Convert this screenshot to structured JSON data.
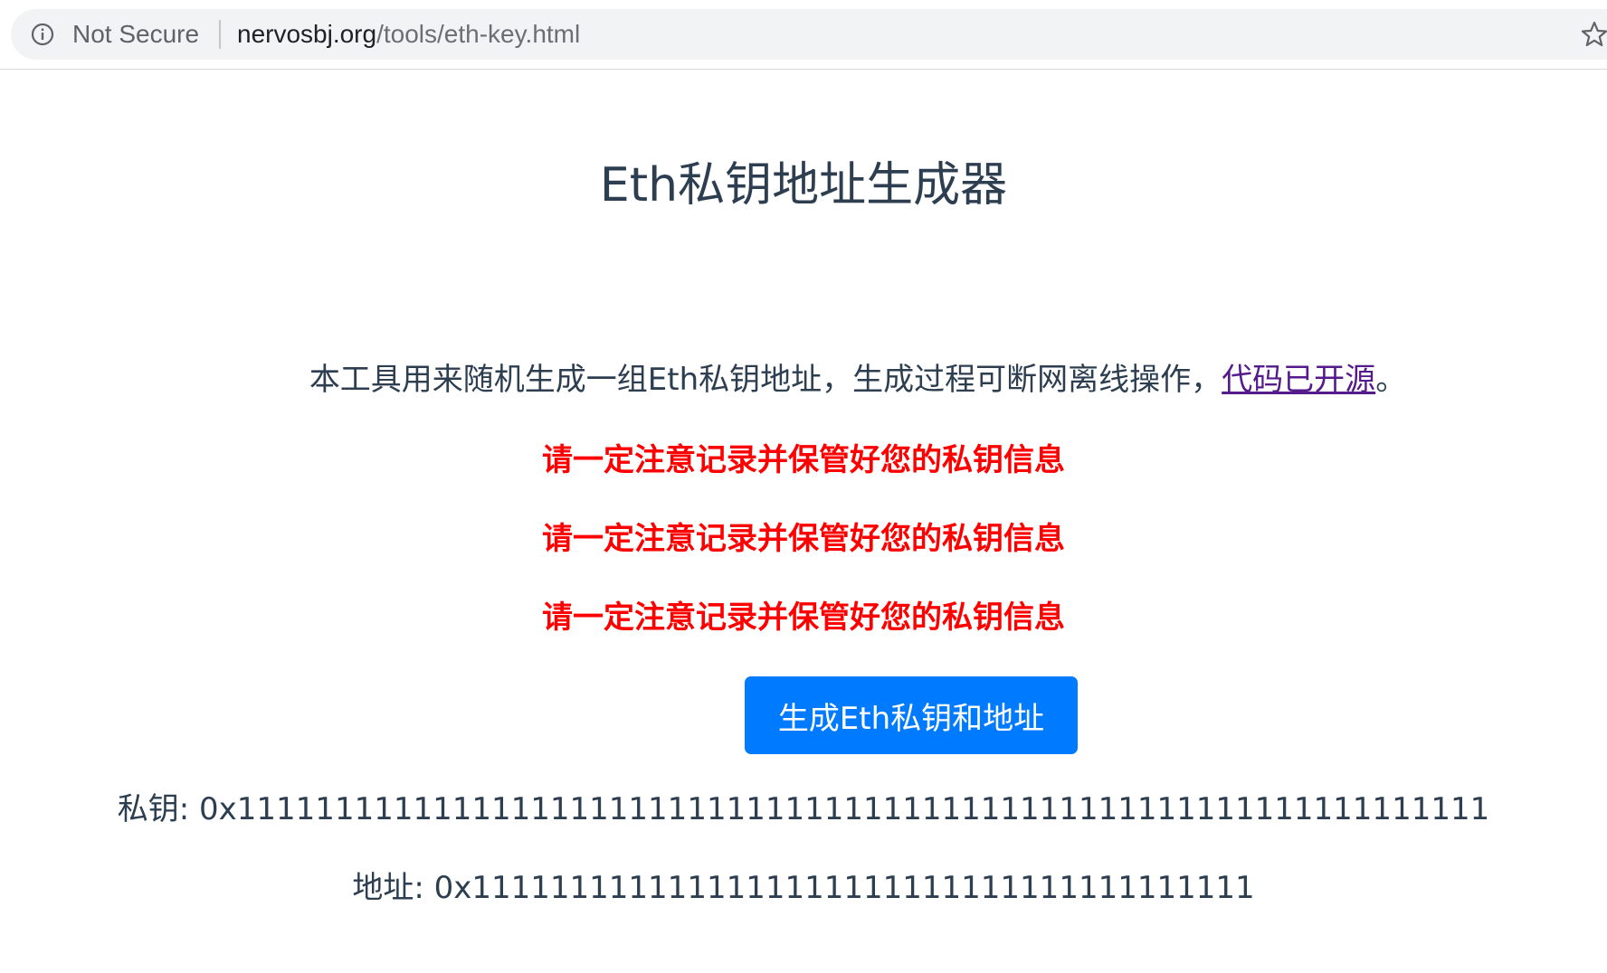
{
  "browser": {
    "security_label": "Not Secure",
    "url_host": "nervosbj.org",
    "url_path": "/tools/eth-key.html",
    "icons": [
      "info-icon",
      "star-icon"
    ]
  },
  "page": {
    "title": "Eth私钥地址生成器",
    "intro_text": "本工具用来随机生成一组Eth私钥地址，生成过程可断网离线操作，",
    "intro_link": "代码已开源",
    "intro_end": "。",
    "warnings": [
      "请一定注意记录并保管好您的私钥信息",
      "请一定注意记录并保管好您的私钥信息",
      "请一定注意记录并保管好您的私钥信息"
    ],
    "generate_button": "生成Eth私钥和地址",
    "private_key_label": "私钥: ",
    "private_key_value": "0x1111111111111111111111111111111111111111111111111111111111111111",
    "address_label": "地址: ",
    "address_value": "0x1111111111111111111111111111111111111111"
  },
  "colors": {
    "warning": "#ff0000",
    "button": "#007bff",
    "text": "#2c3e50",
    "link": "#551a8b"
  }
}
